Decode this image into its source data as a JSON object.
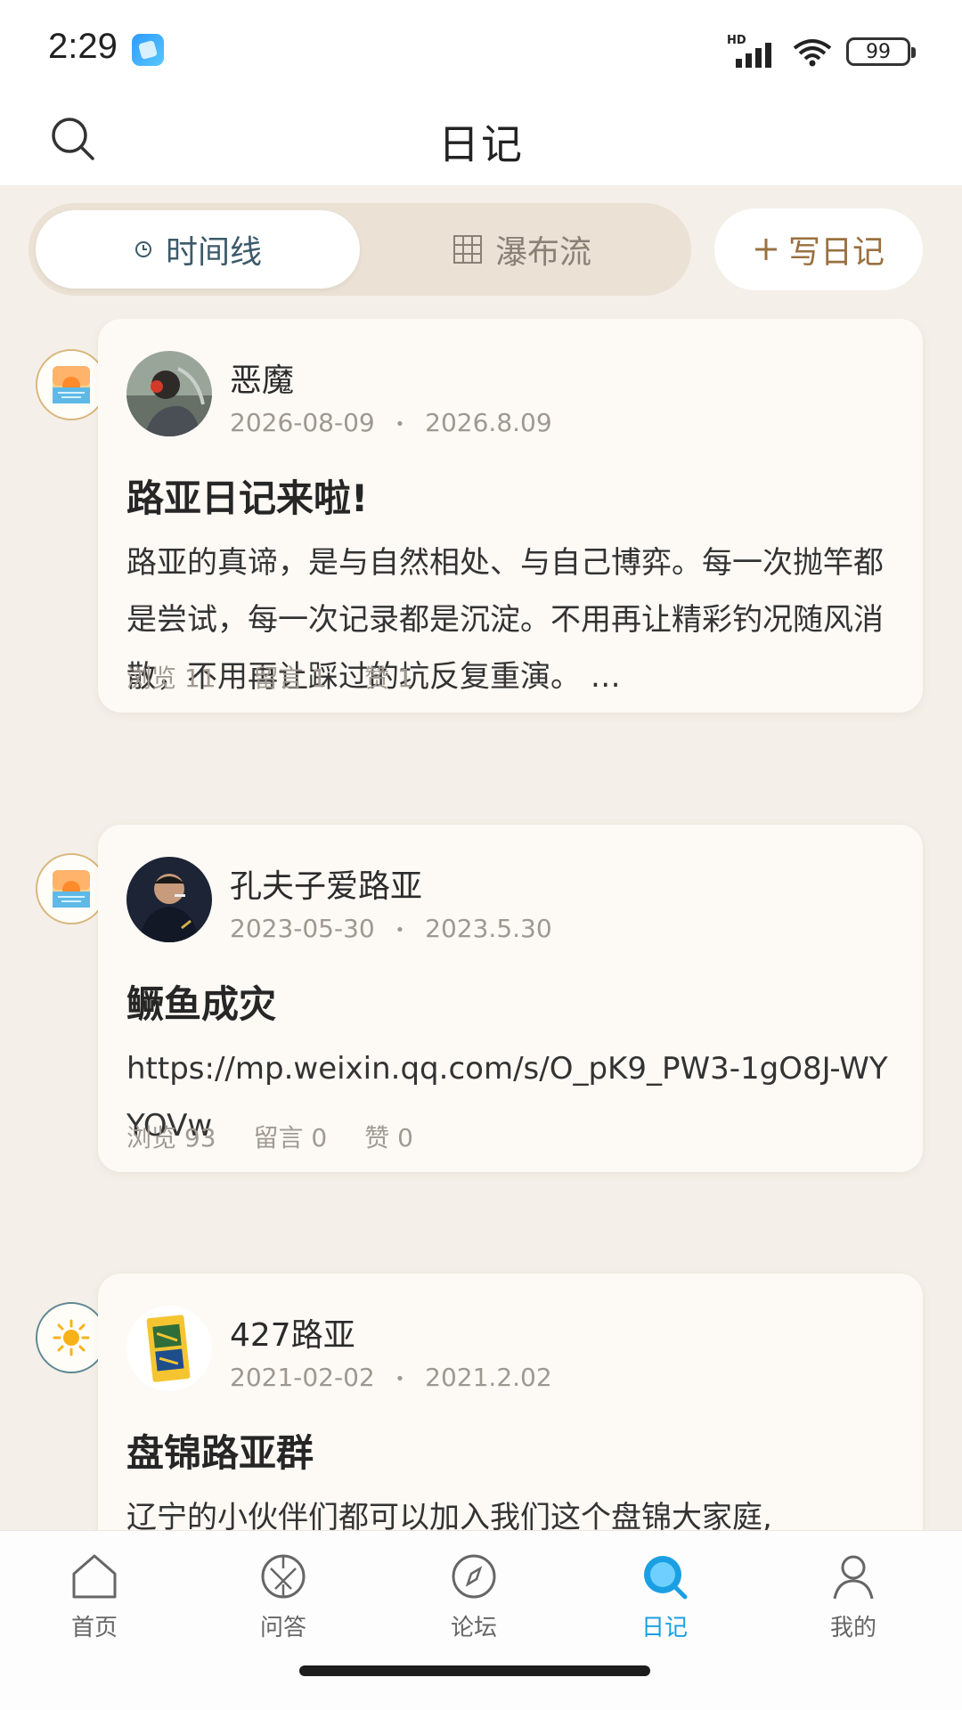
{
  "status_bar": {
    "time": "2:29",
    "battery": "99",
    "network": "HD"
  },
  "header": {
    "title": "日记"
  },
  "tabs": {
    "timeline": "时间线",
    "waterfall": "瀑布流",
    "active": "timeline"
  },
  "write_button": {
    "label": "写日记",
    "icon": "plus-icon"
  },
  "posts": [
    {
      "author": "恶魔",
      "date": "2026-08-09",
      "separator": "•",
      "date_short": "2026.8.09",
      "title": "路亚日记来啦!",
      "body": "路亚的真谛，是与自然相处、与自己博弈。每一次抛竿都是尝试，每一次记录都是沉淀。不用再让精彩钓况随风消散，不用再让踩过的坑反复重演。 …",
      "views": "浏览 11",
      "comments": "留言 1",
      "likes": "赞 1",
      "weather": "sunset-icon"
    },
    {
      "author": "孔夫子爱路亚",
      "date": "2023-05-30",
      "separator": "•",
      "date_short": "2023.5.30",
      "title": "鳜鱼成灾",
      "body": "https://mp.weixin.qq.com/s/O_pK9_PW3-1gO8J-WYYOVw",
      "views": "浏览 93",
      "comments": "留言 0",
      "likes": "赞 0",
      "weather": "sunset-icon"
    },
    {
      "author": "427路亚",
      "date": "2021-02-02",
      "separator": "•",
      "date_short": "2021.2.02",
      "title": "盘锦路亚群",
      "body": "辽宁的小伙伴们都可以加入我们这个盘锦大家庭,",
      "weather": "sun-icon"
    }
  ],
  "bottom_nav": [
    {
      "label": "首页",
      "icon": "home-icon"
    },
    {
      "label": "问答",
      "icon": "qa-icon"
    },
    {
      "label": "论坛",
      "icon": "compass-icon"
    },
    {
      "label": "日记",
      "icon": "diary-icon",
      "active": true
    },
    {
      "label": "我的",
      "icon": "profile-icon"
    }
  ],
  "colors": {
    "accent": "#1a9fe3",
    "background": "#f4efe8",
    "card": "#fdfaf6",
    "write_button": "#9a7040"
  }
}
